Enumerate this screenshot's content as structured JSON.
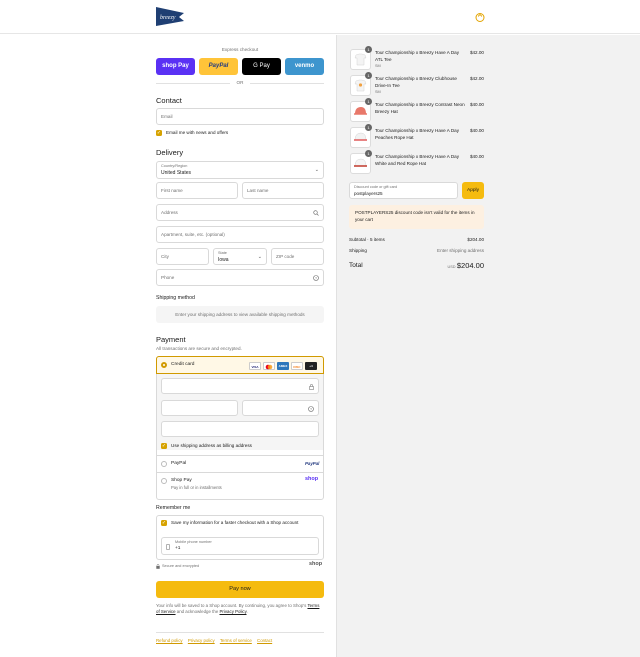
{
  "header": {
    "logo_text": "breezy",
    "cart_icon": "shopping-bag-icon"
  },
  "express": {
    "label": "Express checkout",
    "or": "OR",
    "buttons": [
      {
        "label": "shop Pay",
        "color": "#5a31f4"
      },
      {
        "label": "PayPal",
        "color": "#ffc439"
      },
      {
        "label": "G Pay",
        "color": "#000000"
      },
      {
        "label": "venmo",
        "color": "#3d95ce"
      }
    ]
  },
  "contact": {
    "title": "Contact",
    "email_placeholder": "Email",
    "newsletter_label": "Email me with news and offers"
  },
  "delivery": {
    "title": "Delivery",
    "country_label": "Country/Region",
    "country_value": "United States",
    "first_name": "First name",
    "last_name": "Last name",
    "address": "Address",
    "apartment": "Apartment, suite, etc. (optional)",
    "city": "City",
    "state_label": "State",
    "state_value": "Iowa",
    "zip": "ZIP code",
    "phone": "Phone"
  },
  "shipping": {
    "title": "Shipping method",
    "note": "Enter your shipping address to view available shipping methods"
  },
  "payment": {
    "title": "Payment",
    "subtitle": "All transactions are secure and encrypted.",
    "credit_card_label": "Credit card",
    "card_brands": [
      "VISA",
      "MC",
      "AMEX",
      "DISC",
      "+4"
    ],
    "billing_label": "Use shipping address as billing address",
    "paypal_label": "PayPal",
    "paypal_logo": "PayPal",
    "shoppay_label": "Shop Pay",
    "shoppay_sub": "Pay in full or in installments",
    "shoppay_logo": "shop"
  },
  "remember": {
    "title": "Remember me",
    "save_label": "Save my information for a faster checkout with a Shop account",
    "phone_label": "Mobile phone number",
    "phone_value": "+1",
    "secure_label": "Secure and encrypted",
    "shop_logo": "shop"
  },
  "pay_now": "Pay now",
  "legal": {
    "text1": "Your info will be saved to a Shop account. By continuing, you agree to Shop's",
    "terms": "Terms of Service",
    "text2": "and acknowledge the",
    "privacy": "Privacy Policy",
    "end": "."
  },
  "footer_links": [
    "Refund policy",
    "Privacy policy",
    "Terms of service",
    "Contact"
  ],
  "cart": {
    "items": [
      {
        "title": "Tour Championship x Breezy Have A Day ATL Tee",
        "variant": "SM",
        "price": "$42.00",
        "qty": "1"
      },
      {
        "title": "Tour Championship x Breezy Clubhouse Drive-In Tee",
        "variant": "SM",
        "price": "$42.00",
        "qty": "1"
      },
      {
        "title": "Tour Championship x Breezy Contrast Neon Breezy Hat",
        "variant": "",
        "price": "$40.00",
        "qty": "1"
      },
      {
        "title": "Tour Championship x Breezy Have A Day Peaches Rope Hat",
        "variant": "",
        "price": "$40.00",
        "qty": "1"
      },
      {
        "title": "Tour Championship x Breezy Have A Day White and Red Rope Hat",
        "variant": "",
        "price": "$40.00",
        "qty": "1"
      }
    ],
    "discount_label": "Discount code or gift card",
    "discount_value": "postplayers25",
    "apply": "Apply",
    "error": "POSTPLAYERS25 discount code isn't valid for the items in your cart",
    "subtotal_label": "Subtotal · 5 items",
    "subtotal_value": "$204.00",
    "shipping_label": "Shipping",
    "shipping_value": "Enter shipping address",
    "total_label": "Total",
    "currency": "USD",
    "total_value": "$204.00"
  }
}
